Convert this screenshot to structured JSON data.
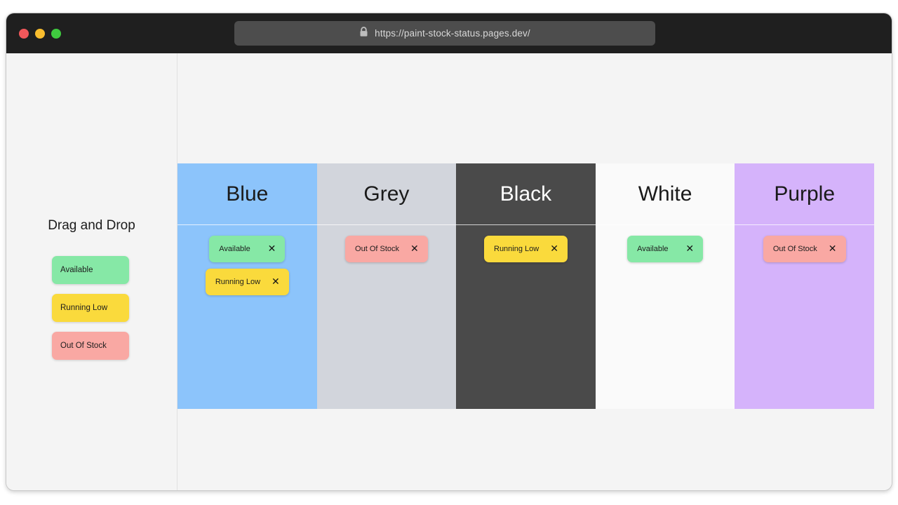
{
  "window": {
    "traffic_lights": [
      {
        "name": "close",
        "color": "#f2585b"
      },
      {
        "name": "minimize",
        "color": "#f9bd2e"
      },
      {
        "name": "maximize",
        "color": "#3fcb3f"
      }
    ],
    "url": "https://paint-stock-status.pages.dev/",
    "lock_icon": "lock-icon"
  },
  "sidebar": {
    "title": "Drag and Drop",
    "palette": [
      {
        "label": "Available",
        "color": "#86e8a6"
      },
      {
        "label": "Running Low",
        "color": "#fada3c"
      },
      {
        "label": "Out Of Stock",
        "color": "#f9a8a3"
      }
    ]
  },
  "board": {
    "columns": [
      {
        "name": "Blue",
        "bg": "#8cc4fb",
        "text_color": "#1a1a1a",
        "chips": [
          {
            "label": "Available",
            "color": "#86e8a6",
            "close": "✕"
          },
          {
            "label": "Running Low",
            "color": "#fada3c",
            "close": "✕"
          }
        ]
      },
      {
        "name": "Grey",
        "bg": "#d2d5dc",
        "text_color": "#1a1a1a",
        "chips": [
          {
            "label": "Out Of Stock",
            "color": "#f9a8a3",
            "close": "✕"
          }
        ]
      },
      {
        "name": "Black",
        "bg": "#4a4a4a",
        "text_color": "#ffffff",
        "chips": [
          {
            "label": "Running Low",
            "color": "#fada3c",
            "close": "✕"
          }
        ]
      },
      {
        "name": "White",
        "bg": "#fafafa",
        "text_color": "#1a1a1a",
        "chips": [
          {
            "label": "Available",
            "color": "#86e8a6",
            "close": "✕"
          }
        ]
      },
      {
        "name": "Purple",
        "bg": "#d5b3fb",
        "text_color": "#1a1a1a",
        "chips": [
          {
            "label": "Out Of Stock",
            "color": "#f9a8a3",
            "close": "✕"
          }
        ]
      }
    ]
  }
}
